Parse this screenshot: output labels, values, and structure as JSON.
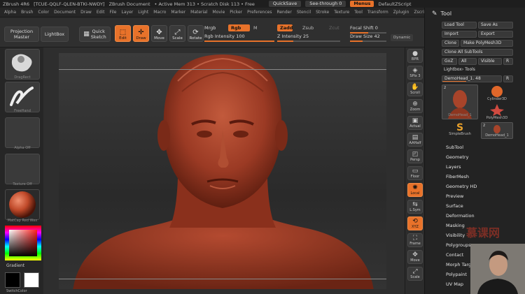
{
  "titlebar": {
    "app": "ZBrush 4R6",
    "serial": "[TCUE-QQLF-QLEN-BTKI-NWDY]",
    "document": "ZBrush Document",
    "mem": "• Active Mem 313 • Scratch Disk 113 • Free",
    "quicksave": "QuickSave",
    "seethrough": "See-through 0",
    "menus": "Menus",
    "script": "DefaultZScript"
  },
  "menubar": [
    "Alpha",
    "Brush",
    "Color",
    "Document",
    "Draw",
    "Edit",
    "File",
    "Layer",
    "Light",
    "Macro",
    "Marker",
    "Material",
    "Movie",
    "Picker",
    "Preferences",
    "Render",
    "Stencil",
    "Stroke",
    "Texture",
    "Tool",
    "Transform",
    "Zplugin",
    "Zscript"
  ],
  "shelf": {
    "projection_master": "Projection Master",
    "lightbox": "LightBox",
    "quick_sketch": "Quick Sketch",
    "tools": [
      {
        "label": "Edit",
        "active": true,
        "icon": "edit-icon"
      },
      {
        "label": "Draw",
        "active": true,
        "icon": "draw-icon"
      },
      {
        "label": "Move",
        "active": false,
        "icon": "move-icon"
      },
      {
        "label": "Scale",
        "active": false,
        "icon": "scale-icon"
      },
      {
        "label": "Rotate",
        "active": false,
        "icon": "rotate-icon"
      }
    ],
    "mrgb": "Mrgb",
    "rgb": "Rgb",
    "m": "M",
    "zadd": "Zadd",
    "zsub": "Zsub",
    "zcut": "Zcut",
    "rgb_intensity_label": "Rgb Intensity",
    "rgb_intensity": 100,
    "z_intensity_label": "Z Intensity",
    "z_intensity": 25,
    "focal_shift_label": "Focal Shift",
    "focal_shift": 0,
    "draw_size_label": "Draw Size",
    "draw_size": 42,
    "dynamic": "Dynamic"
  },
  "leftpanel": {
    "labels": [
      "DragRect",
      "FreeHand",
      "Alpha Off",
      "Texture Off",
      "MatCap Red Wax"
    ],
    "gradient": "Gradient",
    "switch_color": "SwitchColor"
  },
  "rightshelf": [
    {
      "label": "BPR",
      "active": false,
      "icon": "bpr-icon"
    },
    {
      "label": "SPix 3",
      "active": false,
      "icon": "spix-icon"
    },
    {
      "label": "Scroll",
      "active": false,
      "icon": "scroll-icon"
    },
    {
      "label": "Zoom",
      "active": false,
      "icon": "zoom-icon"
    },
    {
      "label": "Actual",
      "active": false,
      "icon": "actual-icon"
    },
    {
      "label": "AAHalf",
      "active": false,
      "icon": "aahalf-icon"
    },
    {
      "label": "Persp",
      "active": false,
      "icon": "persp-icon"
    },
    {
      "label": "Floor",
      "active": false,
      "icon": "floor-icon"
    },
    {
      "label": "Local",
      "active": true,
      "icon": "local-icon"
    },
    {
      "label": "L.Sym",
      "active": false,
      "icon": "lsym-icon"
    },
    {
      "label": "XYZ",
      "active": true,
      "icon": "xyz-icon"
    },
    {
      "label": "Frame",
      "active": false,
      "icon": "frame-icon"
    },
    {
      "label": "Move",
      "active": false,
      "icon": "move-icon"
    },
    {
      "label": "Scale",
      "active": false,
      "icon": "scale-icon"
    }
  ],
  "toolpanel": {
    "title": "Tool",
    "load_tool": "Load Tool",
    "save_as": "Save As",
    "import": "Import",
    "export": "Export",
    "clone": "Clone",
    "make_polymesh": "Make PolyMesh3D",
    "clone_all": "Clone All SubTools",
    "goz": "GoZ",
    "all": "All",
    "visible": "Visible",
    "r": "R",
    "lightbox_tools": "Lightbox› Tools",
    "current_tool": "DemoHead_1. 48",
    "current_r": "R",
    "thumbs": [
      {
        "caption": "DemoHead_1",
        "count": "2"
      },
      {
        "caption": "Cylinder3D",
        "count": ""
      },
      {
        "caption": "PolyMesh3D",
        "count": ""
      },
      {
        "caption": "SimpleBrush",
        "count": ""
      },
      {
        "caption": "DemoHead_1",
        "count": "2"
      }
    ],
    "sections": [
      "SubTool",
      "Geometry",
      "Layers",
      "FiberMesh",
      "Geometry HD",
      "Preview",
      "Surface",
      "Deformation",
      "Masking",
      "Visibility",
      "Polygroups",
      "Contact",
      "Morph Target",
      "Polypaint",
      "UV Map"
    ]
  },
  "watermark": "慕课网"
}
